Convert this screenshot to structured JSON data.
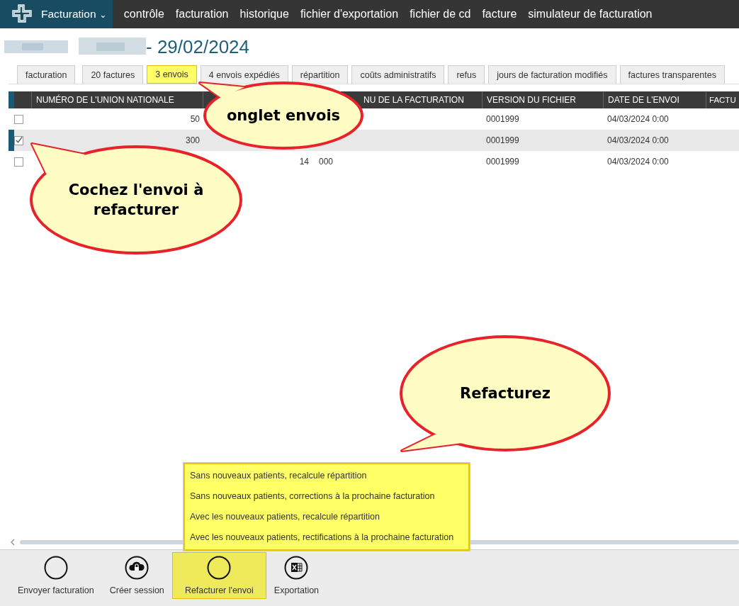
{
  "nav": {
    "brand": "Facturation",
    "caret": "⌄",
    "items": [
      "contrôle",
      "facturation",
      "historique",
      "fichier d'exportation",
      "fichier de cd",
      "facture",
      "simulateur de facturation"
    ]
  },
  "title": {
    "date": "- 29/02/2024"
  },
  "tabs": [
    {
      "label": "facturation",
      "selected": false
    },
    {
      "label": "20 factures",
      "selected": false
    },
    {
      "label": "3 envois",
      "selected": true
    },
    {
      "label": "4 envois expédiés",
      "selected": false
    },
    {
      "label": "répartition",
      "selected": false
    },
    {
      "label": "coûts administratifs",
      "selected": false
    },
    {
      "label": "refus",
      "selected": false
    },
    {
      "label": "jours de facturation modifiés",
      "selected": false
    },
    {
      "label": "factures transparentes",
      "selected": false
    }
  ],
  "table": {
    "columns": [
      "NUMÉRO DE L'UNION NATIONALE",
      "",
      "NU DE LA FACTURATION",
      "VERSION DU FICHIER",
      "DATE DE L'ENVOI",
      "FACTU"
    ],
    "rows": [
      {
        "checked": false,
        "cells": [
          "50",
          "",
          "",
          "0001999",
          "04/03/2024 0:00",
          ""
        ]
      },
      {
        "checked": true,
        "cells": [
          "300",
          "",
          "",
          "0001999",
          "04/03/2024 0:00",
          ""
        ]
      },
      {
        "checked": false,
        "cells": [
          "",
          "14",
          "000",
          "0001999",
          "04/03/2024 0:00",
          ""
        ]
      }
    ]
  },
  "popup_menu": [
    "Sans nouveaux patients, recalcule répartition",
    "Sans nouveaux patients, corrections à la prochaine facturation",
    "Avec les nouveaux patients, recalcule répartition",
    "Avec les nouveaux patients, rectifications à la prochaine facturation"
  ],
  "toolbar": [
    {
      "label": "Envoyer facturation",
      "kind": "blank",
      "selected": false
    },
    {
      "label": "Créer session",
      "kind": "cloud-lock",
      "selected": false
    },
    {
      "label": "Refacturer l'envoi",
      "kind": "blank",
      "selected": true
    },
    {
      "label": "Exportation",
      "kind": "excel",
      "selected": false
    }
  ],
  "callouts": [
    [
      "onglet envois"
    ],
    [
      "Cochez l'envoi à",
      "refacturer"
    ],
    [
      "Refacturez"
    ]
  ]
}
